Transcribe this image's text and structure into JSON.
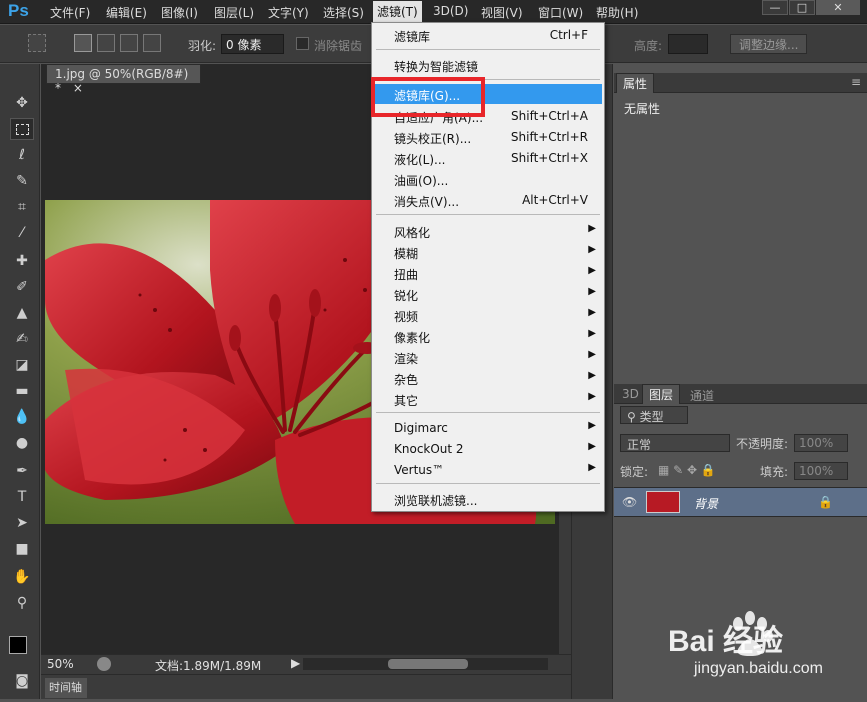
{
  "menubar": {
    "logo": "Ps",
    "items": [
      "文件(F)",
      "编辑(E)",
      "图像(I)",
      "图层(L)",
      "文字(Y)",
      "选择(S)",
      "滤镜(T)",
      "3D(D)",
      "视图(V)",
      "窗口(W)",
      "帮助(H)"
    ],
    "window_controls": [
      "—",
      "□",
      "✕"
    ]
  },
  "options": {
    "feather_label": "羽化:",
    "feather_value": "0 像素",
    "antialias_label": "消除锯齿",
    "height_label": "高度:",
    "refine_edge": "调整边缘..."
  },
  "document": {
    "tab_title": "1.jpg @ 50%(RGB/8#) *",
    "tab_close": "×",
    "zoom": "50%",
    "doc_info": "文档:1.89M/1.89M",
    "timeline": "时间轴"
  },
  "filter_menu": {
    "items": [
      {
        "label": "滤镜库",
        "shortcut": "Ctrl+F"
      },
      {
        "label": "转换为智能滤镜",
        "shortcut": ""
      },
      {
        "label": "滤镜库(G)...",
        "shortcut": ""
      },
      {
        "label": "自适应广角(A)...",
        "shortcut": "Shift+Ctrl+A"
      },
      {
        "label": "镜头校正(R)...",
        "shortcut": "Shift+Ctrl+R"
      },
      {
        "label": "液化(L)...",
        "shortcut": "Shift+Ctrl+X"
      },
      {
        "label": "油画(O)...",
        "shortcut": ""
      },
      {
        "label": "消失点(V)...",
        "shortcut": "Alt+Ctrl+V"
      },
      {
        "label": "风格化",
        "shortcut": ""
      },
      {
        "label": "模糊",
        "shortcut": ""
      },
      {
        "label": "扭曲",
        "shortcut": ""
      },
      {
        "label": "锐化",
        "shortcut": ""
      },
      {
        "label": "视频",
        "shortcut": ""
      },
      {
        "label": "像素化",
        "shortcut": ""
      },
      {
        "label": "渲染",
        "shortcut": ""
      },
      {
        "label": "杂色",
        "shortcut": ""
      },
      {
        "label": "其它",
        "shortcut": ""
      },
      {
        "label": "Digimarc",
        "shortcut": ""
      },
      {
        "label": "KnockOut 2",
        "shortcut": ""
      },
      {
        "label": "Vertus™",
        "shortcut": ""
      },
      {
        "label": "浏览联机滤镜...",
        "shortcut": ""
      }
    ]
  },
  "properties_panel": {
    "tab": "属性",
    "content": "无属性"
  },
  "layers_panel": {
    "tabs": [
      "3D",
      "图层",
      "通道"
    ],
    "filter_kind": "类型",
    "blend_mode": "正常",
    "opacity_label": "不透明度:",
    "opacity_value": "100%",
    "lock_label": "锁定:",
    "fill_label": "填充:",
    "fill_value": "100%",
    "layer_name": "背景"
  },
  "watermark": {
    "brand_text": "Bai 经验",
    "url": "jingyan.baidu.com"
  },
  "colors": {
    "highlight": "#3399ee",
    "annotation_box": "#e8262a",
    "logo": "#3ca3e8"
  }
}
